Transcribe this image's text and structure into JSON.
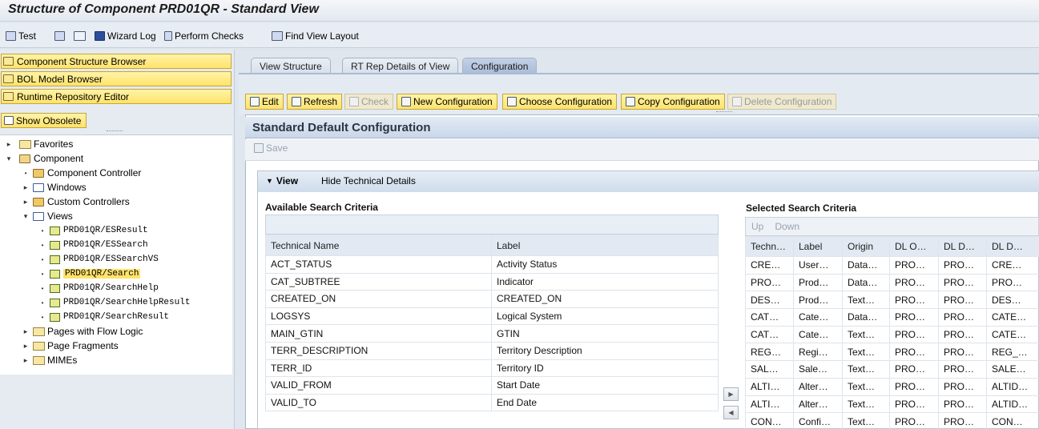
{
  "title": "Structure of Component PRD01QR - Standard View",
  "toolbar": {
    "test": "Test",
    "wizard_log": "Wizard Log",
    "perform_checks": "Perform Checks",
    "find_view_layout": "Find View Layout"
  },
  "left": {
    "buttons": [
      "Component Structure Browser",
      "BOL Model Browser",
      "Runtime Repository Editor"
    ],
    "show_obsolete": "Show Obsolete",
    "tree": {
      "favorites": "Favorites",
      "component": "Component",
      "component_controller": "Component Controller",
      "windows": "Windows",
      "custom_controllers": "Custom Controllers",
      "views": "Views",
      "view_items": [
        "PRD01QR/ESResult",
        "PRD01QR/ESSearch",
        "PRD01QR/ESSearchVS",
        "PRD01QR/Search",
        "PRD01QR/SearchHelp",
        "PRD01QR/SearchHelpResult",
        "PRD01QR/SearchResult"
      ],
      "pages_with_flow_logic": "Pages with Flow Logic",
      "page_fragments": "Page Fragments",
      "mimes": "MIMEs"
    }
  },
  "tabs": [
    "View Structure",
    "RT Rep Details of View",
    "Configuration"
  ],
  "config_buttons": {
    "edit": "Edit",
    "refresh": "Refresh",
    "check": "Check",
    "new_configuration": "New Configuration",
    "choose_configuration": "Choose Configuration",
    "copy_configuration": "Copy Configuration",
    "delete_configuration": "Delete Configuration"
  },
  "config_title": "Standard Default Configuration",
  "save": "Save",
  "view_section": {
    "label": "View",
    "hide_details": "Hide Technical Details"
  },
  "available": {
    "title": "Available Search Criteria",
    "columns": [
      "Technical Name",
      "Label"
    ],
    "rows": [
      [
        "ACT_STATUS",
        "Activity Status"
      ],
      [
        "CAT_SUBTREE",
        "Indicator"
      ],
      [
        "CREATED_ON",
        "CREATED_ON"
      ],
      [
        "LOGSYS",
        "Logical System"
      ],
      [
        "MAIN_GTIN",
        "GTIN"
      ],
      [
        "TERR_DESCRIPTION",
        "Territory Description"
      ],
      [
        "TERR_ID",
        "Territory ID"
      ],
      [
        "VALID_FROM",
        "Start Date"
      ],
      [
        "VALID_TO",
        "End Date"
      ]
    ]
  },
  "selected": {
    "title": "Selected Search Criteria",
    "up": "Up",
    "down": "Down",
    "columns": [
      "Techn…",
      "Label",
      "Origin",
      "DL O…",
      "DL D…",
      "DL D…"
    ],
    "rows": [
      [
        "CRE…",
        "User…",
        "Data…",
        "PRO…",
        "PRO…",
        "CRE…"
      ],
      [
        "PRO…",
        "Prod…",
        "Data…",
        "PRO…",
        "PRO…",
        "PRO…"
      ],
      [
        "DES…",
        "Prod…",
        "Text…",
        "PRO…",
        "PRO…",
        "DES…"
      ],
      [
        "CAT…",
        "Cate…",
        "Data…",
        "PRO…",
        "PRO…",
        "CATE…"
      ],
      [
        "CAT…",
        "Cate…",
        "Text…",
        "PRO…",
        "PRO…",
        "CATE…"
      ],
      [
        "REG…",
        "Regi…",
        "Text…",
        "PRO…",
        "PRO…",
        "REG_…"
      ],
      [
        "SAL…",
        "Sale…",
        "Text…",
        "PRO…",
        "PRO…",
        "SALE…"
      ],
      [
        "ALTI…",
        "Alter…",
        "Text…",
        "PRO…",
        "PRO…",
        "ALTID…"
      ],
      [
        "ALTI…",
        "Alter…",
        "Text…",
        "PRO…",
        "PRO…",
        "ALTID…"
      ],
      [
        "CON…",
        "Confi…",
        "Text…",
        "PRO…",
        "PRO…",
        "CON…"
      ]
    ]
  }
}
